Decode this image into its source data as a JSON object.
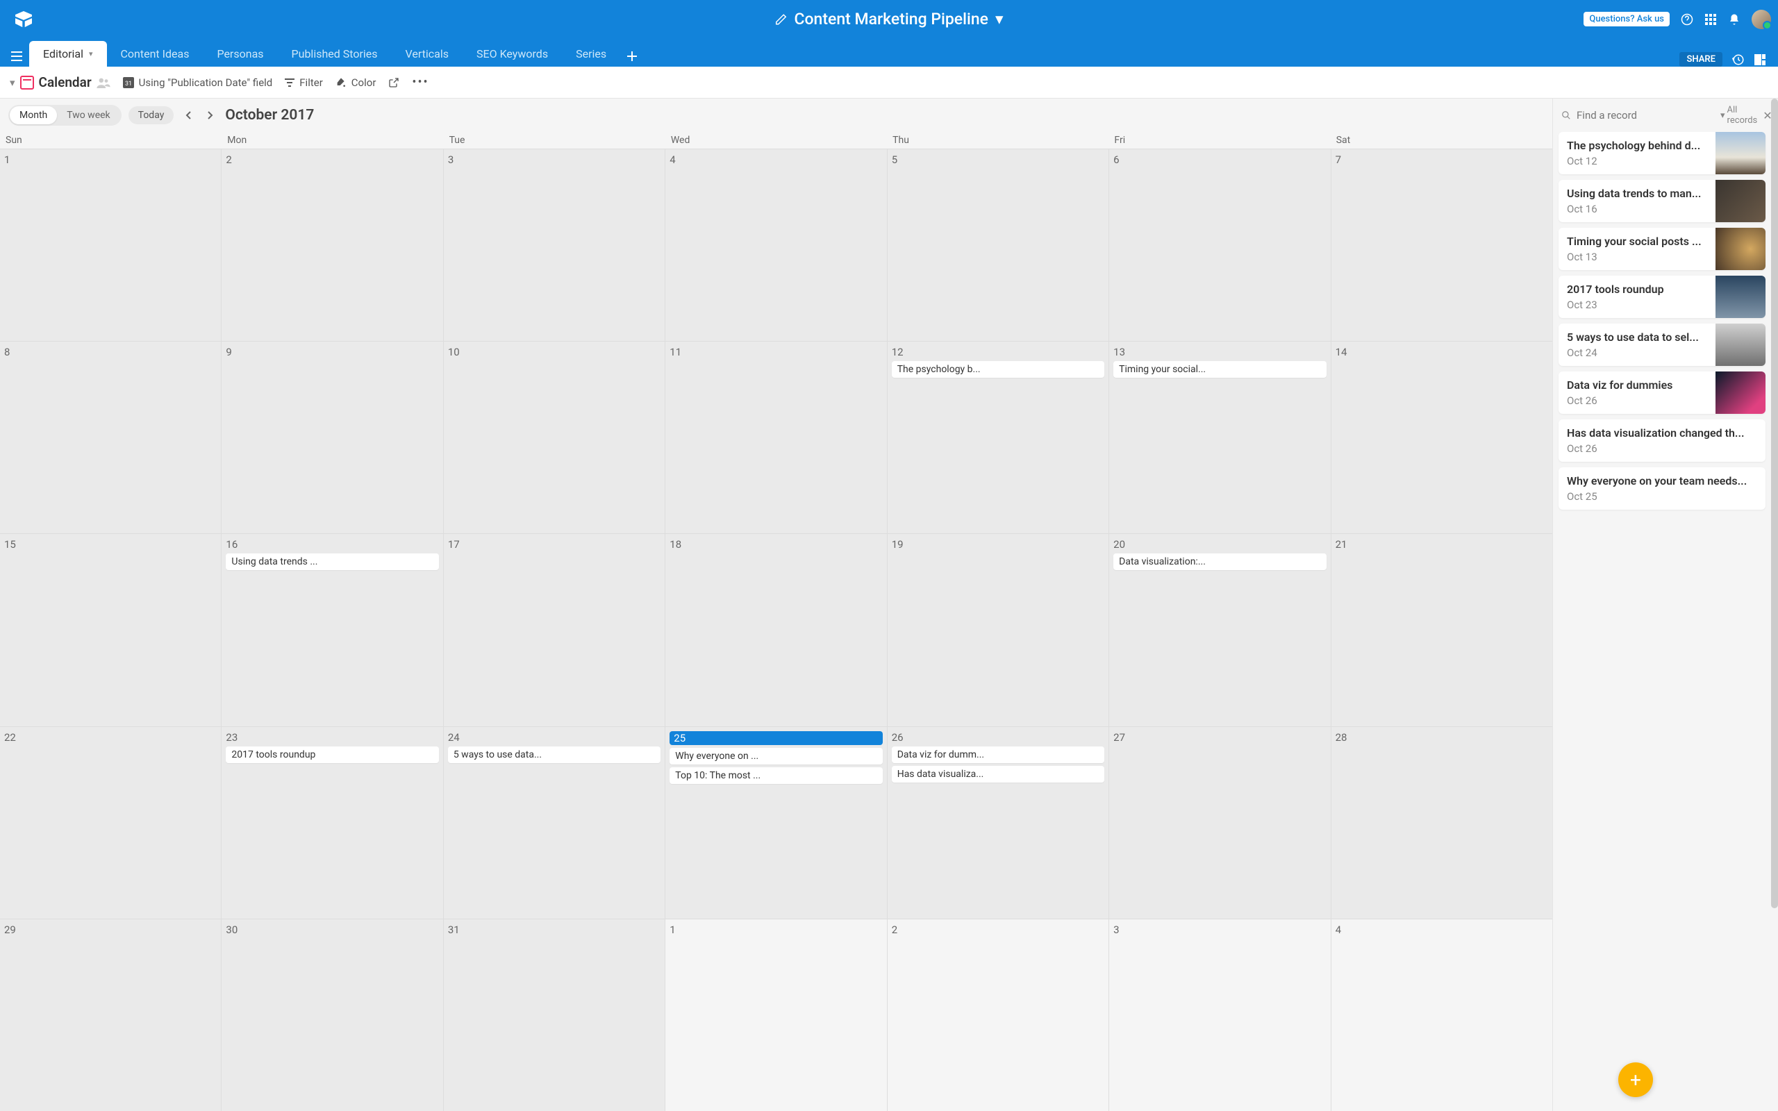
{
  "header": {
    "title": "Content Marketing Pipeline",
    "questions": "Questions? Ask us"
  },
  "tabs": [
    "Editorial",
    "Content Ideas",
    "Personas",
    "Published Stories",
    "Verticals",
    "SEO Keywords",
    "Series"
  ],
  "share": "SHARE",
  "toolbar": {
    "view": "Calendar",
    "using": "Using \"Publication Date\" field",
    "filter": "Filter",
    "color": "Color"
  },
  "calendar": {
    "seg_month": "Month",
    "seg_twoweek": "Two week",
    "today": "Today",
    "period": "October 2017",
    "dow": [
      "Sun",
      "Mon",
      "Tue",
      "Wed",
      "Thu",
      "Fri",
      "Sat"
    ],
    "cells": [
      {
        "n": "1"
      },
      {
        "n": "2"
      },
      {
        "n": "3"
      },
      {
        "n": "4"
      },
      {
        "n": "5"
      },
      {
        "n": "6"
      },
      {
        "n": "7"
      },
      {
        "n": "8"
      },
      {
        "n": "9"
      },
      {
        "n": "10"
      },
      {
        "n": "11"
      },
      {
        "n": "12",
        "ev": [
          "The psychology b..."
        ]
      },
      {
        "n": "13",
        "ev": [
          "Timing your social..."
        ]
      },
      {
        "n": "14"
      },
      {
        "n": "15"
      },
      {
        "n": "16",
        "ev": [
          "Using data trends ..."
        ]
      },
      {
        "n": "17"
      },
      {
        "n": "18"
      },
      {
        "n": "19"
      },
      {
        "n": "20",
        "ev": [
          "Data visualization:..."
        ]
      },
      {
        "n": "21"
      },
      {
        "n": "22"
      },
      {
        "n": "23",
        "ev": [
          "2017 tools roundup"
        ]
      },
      {
        "n": "24",
        "ev": [
          "5 ways to use data..."
        ]
      },
      {
        "n": "25",
        "today": true,
        "ev": [
          "Why everyone on ...",
          "Top 10: The most ..."
        ]
      },
      {
        "n": "26",
        "ev": [
          "Data viz for dumm...",
          "Has data visualiza..."
        ]
      },
      {
        "n": "27"
      },
      {
        "n": "28"
      },
      {
        "n": "29"
      },
      {
        "n": "30"
      },
      {
        "n": "31"
      },
      {
        "n": "1",
        "other": true
      },
      {
        "n": "2",
        "other": true
      },
      {
        "n": "3",
        "other": true
      },
      {
        "n": "4",
        "other": true
      }
    ]
  },
  "side": {
    "placeholder": "Find a record",
    "filter": "All records",
    "records": [
      {
        "title": "The psychology behind d...",
        "date": "Oct 12",
        "img": "ci0"
      },
      {
        "title": "Using data trends to man...",
        "date": "Oct 16",
        "img": "ci1"
      },
      {
        "title": "Timing your social posts ...",
        "date": "Oct 13",
        "img": "ci2"
      },
      {
        "title": "2017 tools roundup",
        "date": "Oct 23",
        "img": "ci3"
      },
      {
        "title": "5 ways to use data to sel...",
        "date": "Oct 24",
        "img": "ci4"
      },
      {
        "title": "Data viz for dummies",
        "date": "Oct 26",
        "img": "ci5"
      },
      {
        "title": "Has data visualization changed th...",
        "date": "Oct 26"
      },
      {
        "title": "Why everyone on your team needs...",
        "date": "Oct 25"
      }
    ]
  }
}
